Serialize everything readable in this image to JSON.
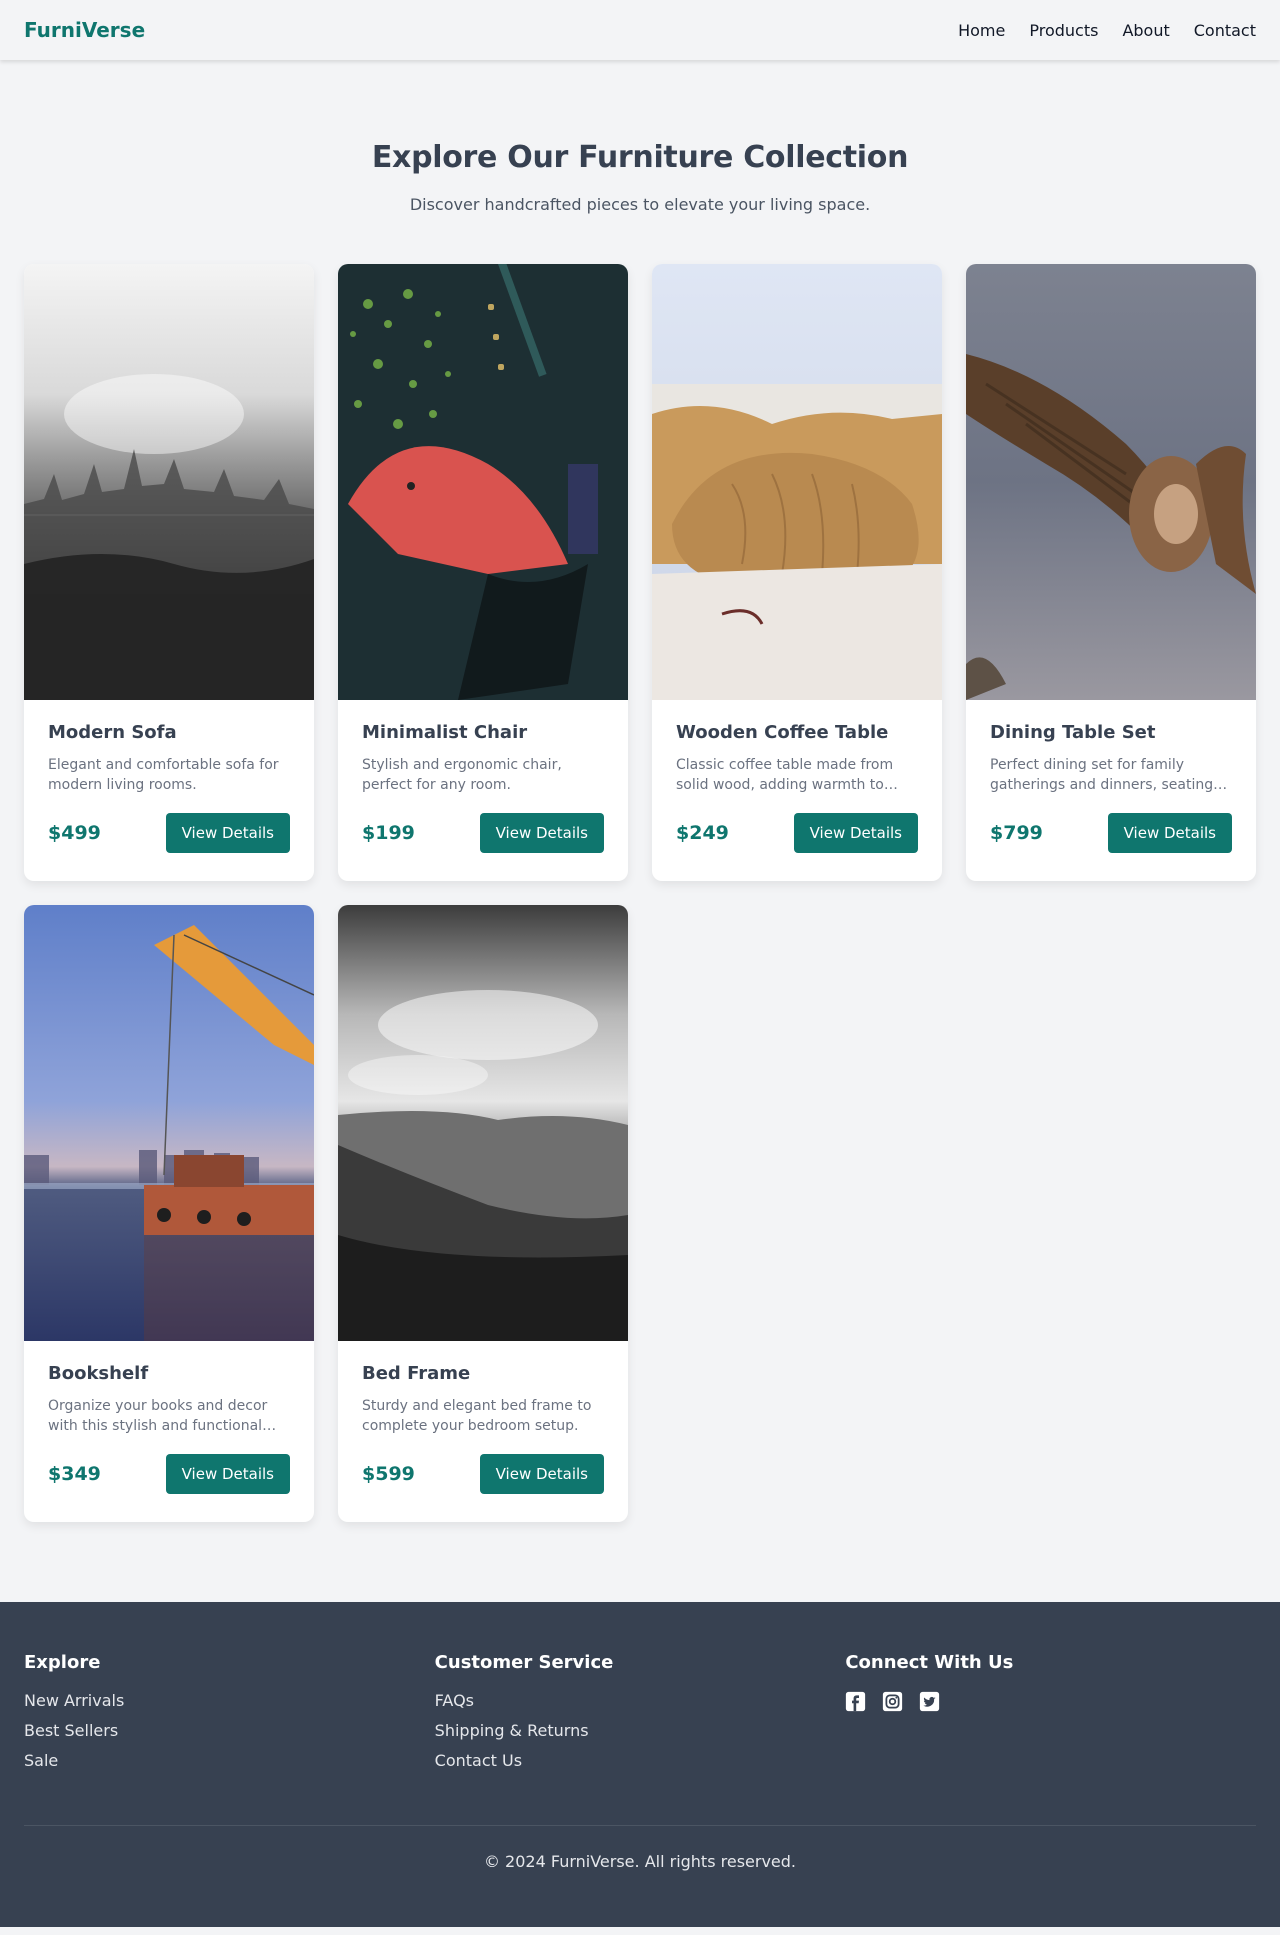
{
  "header": {
    "logo": "FurniVerse",
    "nav": [
      {
        "label": "Home"
      },
      {
        "label": "Products"
      },
      {
        "label": "About"
      },
      {
        "label": "Contact"
      }
    ]
  },
  "hero": {
    "title": "Explore Our Furniture Collection",
    "subtitle": "Discover handcrafted pieces to elevate your living space."
  },
  "products": [
    {
      "title": "Modern Sofa",
      "description": "Elegant and comfortable sofa for modern living rooms.",
      "price": "$499",
      "button": "View Details",
      "image": "grayscale city skyline"
    },
    {
      "title": "Minimalist Chair",
      "description": "Stylish and ergonomic chair, perfect for any room.",
      "price": "$199",
      "button": "View Details",
      "image": "red umbrella with bokeh lights"
    },
    {
      "title": "Wooden Coffee Table",
      "description": "Classic coffee table made from solid wood, adding warmth to your space.",
      "price": "$249",
      "button": "View Details",
      "image": "walruses on a beach"
    },
    {
      "title": "Dining Table Set",
      "description": "Perfect dining set for family gatherings and dinners, seating up to six.",
      "price": "$799",
      "button": "View Details",
      "image": "vulture in flight"
    },
    {
      "title": "Bookshelf",
      "description": "Organize your books and decor with this stylish and functional bookshelf.",
      "price": "$349",
      "button": "View Details",
      "image": "crane barge at dusk"
    },
    {
      "title": "Bed Frame",
      "description": "Sturdy and elegant bed frame to complete your bedroom setup.",
      "price": "$599",
      "button": "View Details",
      "image": "grayscale mountain valley"
    }
  ],
  "footer": {
    "explore": {
      "heading": "Explore",
      "links": [
        "New Arrivals",
        "Best Sellers",
        "Sale"
      ]
    },
    "service": {
      "heading": "Customer Service",
      "links": [
        "FAQs",
        "Shipping & Returns",
        "Contact Us"
      ]
    },
    "connect": {
      "heading": "Connect With Us",
      "icons": [
        "facebook-icon",
        "instagram-icon",
        "twitter-icon"
      ]
    },
    "copyright": "© 2024 FurniVerse. All rights reserved."
  },
  "colors": {
    "brand": "#0f766e",
    "footer_bg": "#374151",
    "page_bg": "#f3f4f6"
  }
}
